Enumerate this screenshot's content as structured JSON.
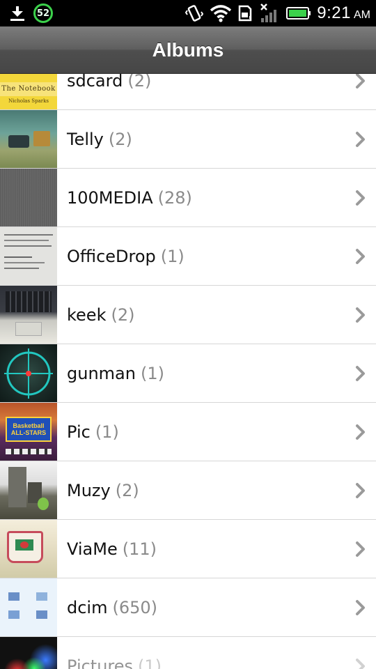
{
  "status_bar": {
    "battery_badge": "52",
    "time": "9:21",
    "ampm": "AM",
    "icons": [
      "download-icon",
      "battery-saver-badge",
      "vibrate-icon",
      "wifi-icon",
      "sd-card-icon",
      "no-signal-icon",
      "battery-icon"
    ]
  },
  "header": {
    "title": "Albums"
  },
  "albums": [
    {
      "name": "sdcard",
      "count": "(2)"
    },
    {
      "name": "Telly",
      "count": "(2)"
    },
    {
      "name": "100MEDIA",
      "count": "(28)"
    },
    {
      "name": "OfficeDrop",
      "count": "(1)"
    },
    {
      "name": "keek",
      "count": "(2)"
    },
    {
      "name": "gunman",
      "count": "(1)"
    },
    {
      "name": "Pic",
      "count": "(1)"
    },
    {
      "name": "Muzy",
      "count": "(2)"
    },
    {
      "name": "ViaMe",
      "count": "(11)"
    },
    {
      "name": "dcim",
      "count": "(650)"
    },
    {
      "name": "Pictures",
      "count": "(1)"
    }
  ],
  "thumb_text": {
    "notebook_title": "The Notebook",
    "notebook_author": "Nicholas Sparks",
    "pic_title": "Basketball ALL-STARS"
  },
  "colors": {
    "accent_green": "#3bd14b",
    "count_grey": "#8a8a8a",
    "divider": "#d6d6d6"
  }
}
